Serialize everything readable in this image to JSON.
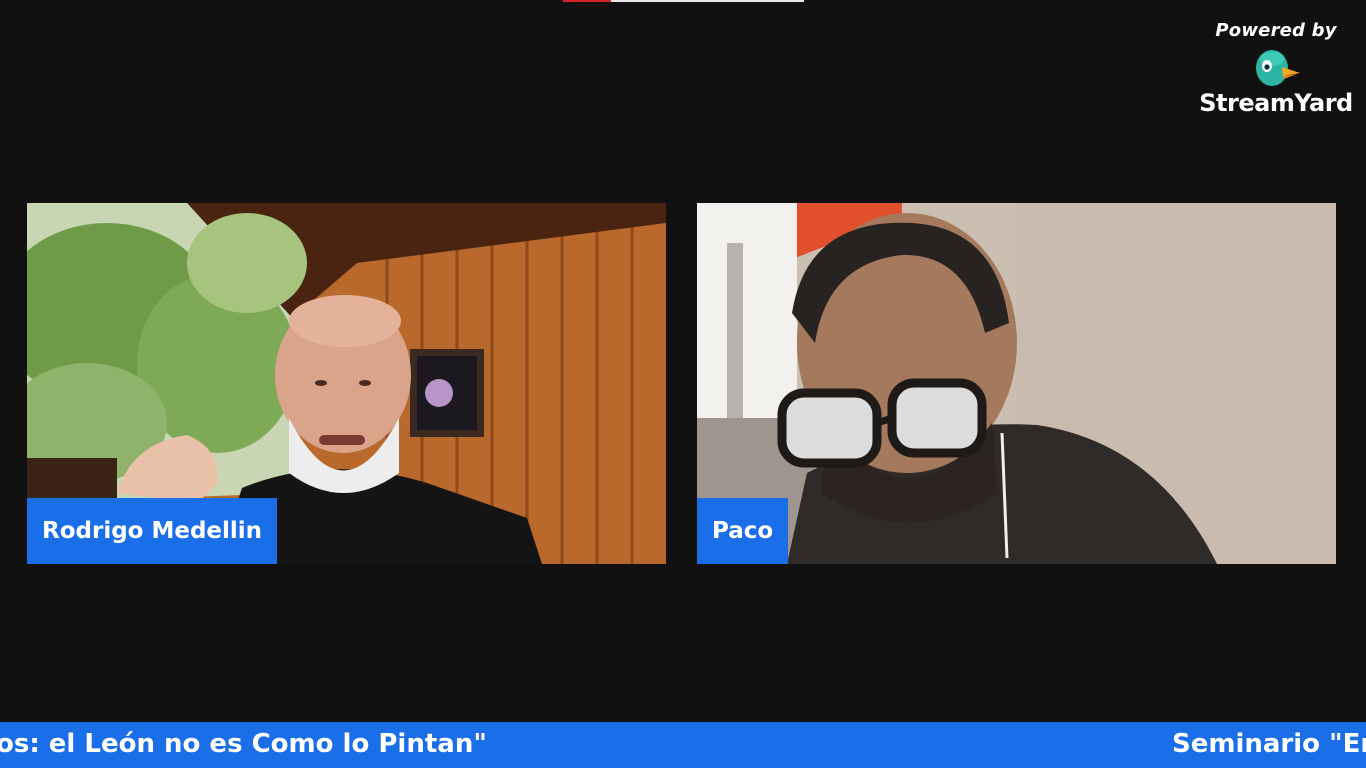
{
  "branding": {
    "powered_by": "Powered by",
    "brand_name": "StreamYard",
    "logo_icon": "streamyard-duck-logo-icon"
  },
  "participants": [
    {
      "name": "Rodrigo Medellin"
    },
    {
      "name": "Paco"
    }
  ],
  "ticker": {
    "text_left": "os: el León no es Como lo Pintan\"",
    "text_right": "Seminario \"Er"
  },
  "colors": {
    "accent": "#1a6ee8",
    "background": "#111111"
  }
}
